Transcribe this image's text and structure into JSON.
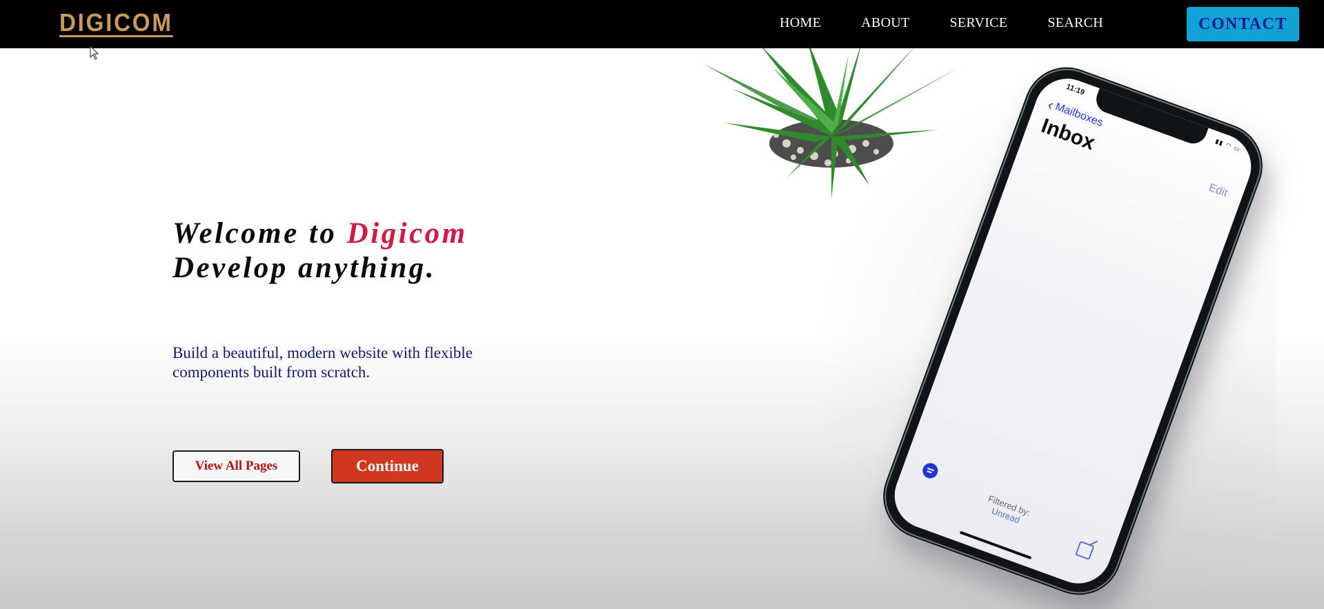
{
  "navbar": {
    "logo": "DIGICOM",
    "links": [
      "HOME",
      "ABOUT",
      "SERVICE",
      "SEARCH"
    ],
    "contact_label": "CONTACT"
  },
  "hero": {
    "title_prefix": "Welcome to ",
    "title_accent": "Digicom",
    "title_line2": "Develop anything.",
    "subtitle": "Build a beautiful, modern website with flexible components built from scratch.",
    "btn_view_all": "View All Pages",
    "btn_continue": "Continue"
  },
  "phone": {
    "time": "11:19",
    "back_label": "Mailboxes",
    "title": "Inbox",
    "edit_label": "Edit",
    "filtered_by": "Filtered by:",
    "filter_value": "Unread"
  },
  "colors": {
    "logo": "#c99a5b",
    "contact_bg": "#12a3d6",
    "accent": "#d01a42",
    "continue_bg": "#d0391f"
  }
}
